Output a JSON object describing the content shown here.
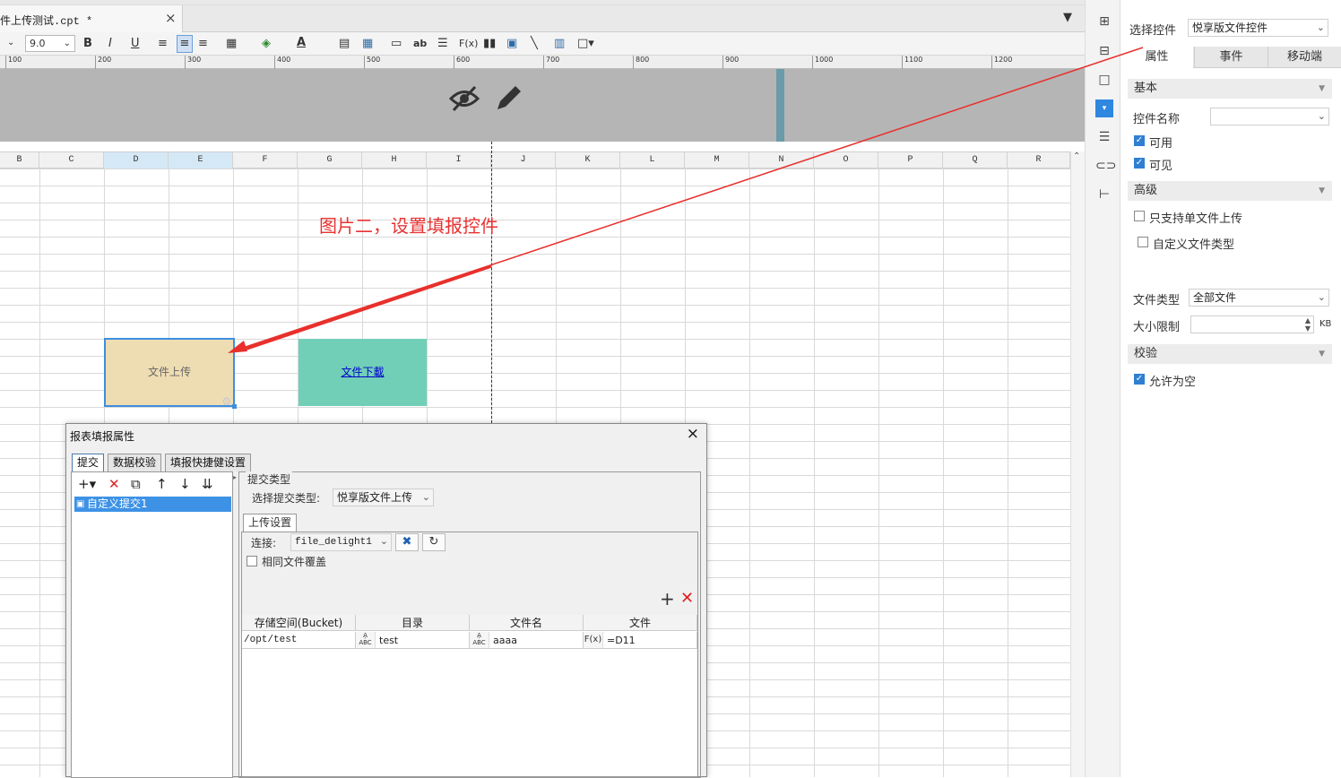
{
  "file_tab": {
    "title": "件上传测试.cpt *",
    "close": "×"
  },
  "toolbar": {
    "font_size": "9.0",
    "bold": "B",
    "italic": "I",
    "underline": "U",
    "text_a": "A",
    "ab": "ab",
    "fx": "F(x)"
  },
  "ruler_ticks": [
    "100",
    "200",
    "300",
    "400",
    "500",
    "600",
    "700",
    "800",
    "900",
    "1000",
    "1100",
    "1200"
  ],
  "columns": [
    "B",
    "C",
    "D",
    "E",
    "F",
    "G",
    "H",
    "I",
    "J",
    "K",
    "L",
    "M",
    "N",
    "O",
    "P",
    "Q",
    "R"
  ],
  "cells": {
    "upload": "文件上传",
    "download": "文件下載"
  },
  "annotation": "图片二，设置填报控件",
  "panel": {
    "select_label": "选择控件",
    "select_value": "悦享版文件控件",
    "tabs": [
      "属性",
      "事件",
      "移动端"
    ],
    "section_basic": "基本",
    "name_label": "控件名称",
    "name_value": "",
    "enabled_label": "可用",
    "enabled": true,
    "visible_label": "可见",
    "visible": true,
    "section_advanced": "高级",
    "single_upload_label": "只支持单文件上传",
    "single_upload": false,
    "custom_type_label": "自定义文件类型",
    "custom_type": false,
    "file_type_label": "文件类型",
    "file_type_value": "全部文件",
    "size_label": "大小限制",
    "size_value": "",
    "size_unit": "KB",
    "section_verify": "校验",
    "allow_empty_label": "允许为空",
    "allow_empty": true
  },
  "dialog": {
    "title": "报表填报属性",
    "tabs": [
      "提交",
      "数据校验",
      "填报快捷健设置"
    ],
    "list_item": "自定义提交1",
    "group_title": "提交类型",
    "submit_type_label": "选择提交类型:",
    "submit_type_value": "悦享版文件上传",
    "upload_tab": "上传设置",
    "conn_label": "连接:",
    "conn_value": "file_delight1",
    "overwrite_label": "相同文件覆盖",
    "overwrite": false,
    "table": {
      "headers": [
        "存储空间(Bucket)",
        "目录",
        "文件名",
        "文件"
      ],
      "row": {
        "bucket": "/opt/test",
        "dir": "test",
        "filename": "aaaa",
        "file": "=D11"
      }
    },
    "abc_icon": "A͎ͣ\nABC",
    "fx_icon": "F(x)"
  }
}
